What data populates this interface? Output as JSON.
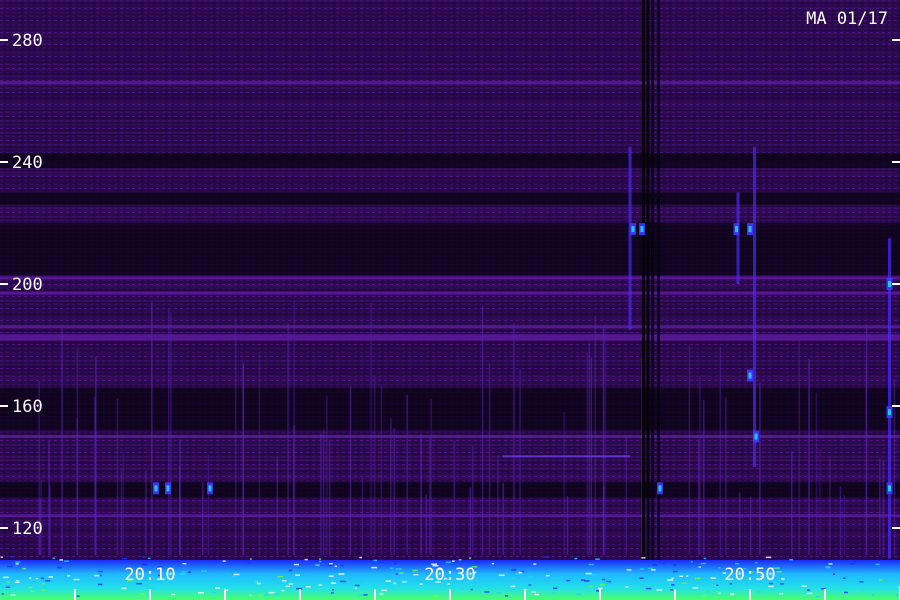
{
  "chart_data": {
    "type": "heatmap",
    "title": "",
    "label": "MA 01/17",
    "xlabel": "",
    "ylabel": "",
    "y_ticks": [
      {
        "value": 280,
        "label": "280"
      },
      {
        "value": 240,
        "label": "240"
      },
      {
        "value": 200,
        "label": "200"
      },
      {
        "value": 160,
        "label": "160"
      },
      {
        "value": 120,
        "label": "120"
      }
    ],
    "ylim": [
      105,
      292
    ],
    "x_ticks": [
      {
        "value": 10,
        "label": "20:10"
      },
      {
        "value": 30,
        "label": "20:30"
      },
      {
        "value": 50,
        "label": "20:50"
      }
    ],
    "xlim": [
      2,
      60
    ],
    "minor_x_ticks": [
      5,
      10,
      15,
      20,
      25,
      30,
      35,
      40,
      45,
      50,
      55,
      60
    ],
    "grid": false,
    "colors": {
      "background": "#1a0630",
      "band_dark": "#080310",
      "band_mid": "#3a0f66",
      "band_bright": "#5a1a9a",
      "signal_blue": "#3b3bff",
      "signal_cyan": "#22d3ff",
      "noise_green": "#4cff6a",
      "text": "#ffffff"
    },
    "dark_bands": [
      {
        "y0": 238,
        "y1": 243
      },
      {
        "y0": 226,
        "y1": 230
      },
      {
        "y0": 203,
        "y1": 220
      },
      {
        "y0": 152,
        "y1": 166
      },
      {
        "y0": 130,
        "y1": 135
      }
    ],
    "bright_lines": [
      {
        "y": 266
      },
      {
        "y": 202
      },
      {
        "y": 197
      },
      {
        "y": 186
      },
      {
        "y": 183
      },
      {
        "y": 182
      },
      {
        "y": 150
      },
      {
        "y": 124
      }
    ],
    "vertical_dark_x": [
      42.8,
      43.1,
      43.4,
      43.8
    ],
    "vertical_bright": [
      {
        "x": 42.0,
        "y0": 185,
        "y1": 245
      },
      {
        "x": 49.2,
        "y0": 200,
        "y1": 230
      },
      {
        "x": 50.3,
        "y0": 140,
        "y1": 245
      },
      {
        "x": 59.3,
        "y0": 110,
        "y1": 215
      }
    ],
    "blue_blobs": [
      {
        "x": 10.4,
        "y": 133
      },
      {
        "x": 11.2,
        "y": 133
      },
      {
        "x": 14.0,
        "y": 133
      },
      {
        "x": 42.2,
        "y": 218
      },
      {
        "x": 42.8,
        "y": 218
      },
      {
        "x": 49.1,
        "y": 218
      },
      {
        "x": 50.0,
        "y": 218
      },
      {
        "x": 50.0,
        "y": 170
      },
      {
        "x": 50.4,
        "y": 150
      },
      {
        "x": 44.0,
        "y": 133
      },
      {
        "x": 59.3,
        "y": 158
      },
      {
        "x": 59.3,
        "y": 133
      },
      {
        "x": 59.3,
        "y": 200
      }
    ],
    "horizontal_segment": {
      "x0": 33.5,
      "x1": 42.0,
      "y": 143.5
    }
  }
}
